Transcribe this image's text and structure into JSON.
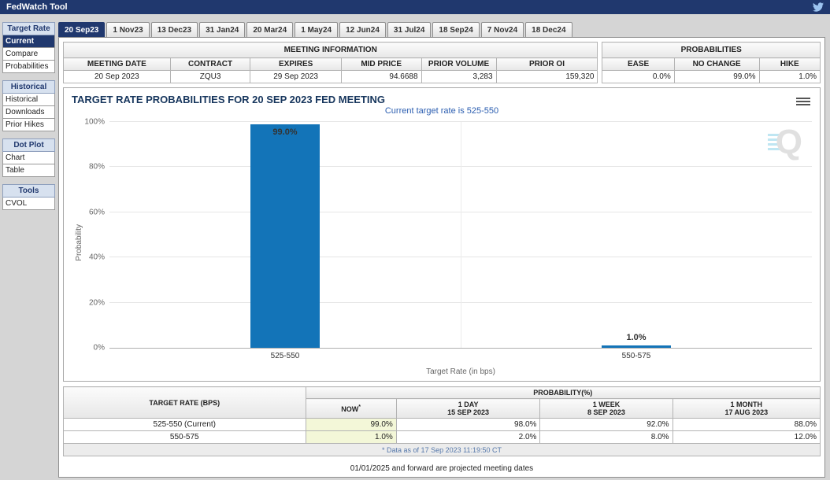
{
  "header": {
    "title": "FedWatch Tool"
  },
  "sidebar": {
    "sections": [
      {
        "title": "Target Rate",
        "items": [
          "Current",
          "Compare",
          "Probabilities"
        ]
      },
      {
        "title": "Historical",
        "items": [
          "Historical",
          "Downloads",
          "Prior Hikes"
        ]
      },
      {
        "title": "Dot Plot",
        "items": [
          "Chart",
          "Table"
        ]
      },
      {
        "title": "Tools",
        "items": [
          "CVOL"
        ]
      }
    ],
    "selected_item": "Current"
  },
  "tabs": [
    "20 Sep23",
    "1 Nov23",
    "13 Dec23",
    "31 Jan24",
    "20 Mar24",
    "1 May24",
    "12 Jun24",
    "31 Jul24",
    "18 Sep24",
    "7 Nov24",
    "18 Dec24"
  ],
  "selected_tab": "20 Sep23",
  "meeting_info": {
    "title": "MEETING INFORMATION",
    "headers": [
      "MEETING DATE",
      "CONTRACT",
      "EXPIRES",
      "MID PRICE",
      "PRIOR VOLUME",
      "PRIOR OI"
    ],
    "values": [
      "20 Sep 2023",
      "ZQU3",
      "29 Sep 2023",
      "94.6688",
      "3,283",
      "159,320"
    ]
  },
  "probabilities_summary": {
    "title": "PROBABILITIES",
    "headers": [
      "EASE",
      "NO CHANGE",
      "HIKE"
    ],
    "values": [
      "0.0%",
      "99.0%",
      "1.0%"
    ]
  },
  "chart_data": {
    "type": "bar",
    "title": "TARGET RATE PROBABILITIES FOR 20 SEP 2023 FED MEETING",
    "subtitle": "Current target rate is 525-550",
    "categories": [
      "525-550",
      "550-575"
    ],
    "values": [
      99.0,
      1.0
    ],
    "value_labels": [
      "99.0%",
      "1.0%"
    ],
    "ylabel": "Probability",
    "xlabel": "Target Rate (in bps)",
    "yticks": [
      "0%",
      "20%",
      "40%",
      "60%",
      "80%",
      "100%"
    ],
    "ylim": [
      0,
      100
    ],
    "grid": true,
    "bar_color": "#1374b8"
  },
  "probability_table": {
    "rate_header": "TARGET RATE (BPS)",
    "col_group_header": "PROBABILITY(%)",
    "columns": [
      {
        "label": "NOW",
        "sup": "*",
        "date": ""
      },
      {
        "label": "1 DAY",
        "date": "15 SEP 2023"
      },
      {
        "label": "1 WEEK",
        "date": "8 SEP 2023"
      },
      {
        "label": "1 MONTH",
        "date": "17 AUG 2023"
      }
    ],
    "rows": [
      {
        "rate": "525-550 (Current)",
        "now": "99.0%",
        "day": "98.0%",
        "week": "92.0%",
        "month": "88.0%"
      },
      {
        "rate": "550-575",
        "now": "1.0%",
        "day": "2.0%",
        "week": "8.0%",
        "month": "12.0%"
      }
    ],
    "footnote": "* Data as of 17 Sep 2023 11:19:50 CT"
  },
  "footer_note": "01/01/2025 and forward are projected meeting dates",
  "colors": {
    "navy": "#20386e",
    "bar": "#1374b8",
    "now_highlight": "#f3f7d8"
  }
}
